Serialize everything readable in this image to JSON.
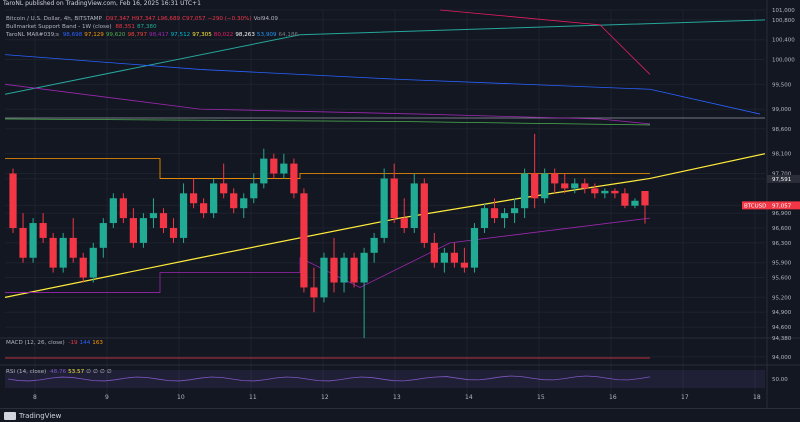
{
  "header": {
    "publisher": "TaroNL published on TradingView.com, Feb 16, 2025 16:31 UTC+1"
  },
  "legend": {
    "title_line": "Bitcoin / U.S. Dollar, 4h, BITSTAMP",
    "ohlc": [
      "O97,347",
      "H97,347",
      "L96,689",
      "C97,057",
      "−290 (−0.30%)",
      "Vol94.09"
    ],
    "band_label": "Bullmarket Support Band - 1W (close)",
    "band_values": [
      "88,351",
      "87,380"
    ],
    "ma_label": "TaroNL MAß#039;s",
    "ma_values": [
      "98,698",
      "97,129",
      "99,620",
      "98,797",
      "98,417",
      "97,512",
      "97,305",
      "80,022",
      "98,263",
      "53,909",
      "64,186"
    ],
    "ma_colors": [
      "#2962ff",
      "#ff9800",
      "#4caf50",
      "#f44336",
      "#9c27b0",
      "#00bcd4",
      "#ffeb3b",
      "#e91e63",
      "#ffffff",
      "#2196f3",
      "#787b86"
    ]
  },
  "macd": {
    "label": "MACD (12, 26, close)",
    "values": [
      "-19",
      "144",
      "163"
    ],
    "colors": [
      "#f23645",
      "#2962ff",
      "#ff9800"
    ]
  },
  "rsi": {
    "label": "RSI (14, close)",
    "values": [
      "48.76",
      "53.57",
      "∅",
      "∅",
      "∅",
      "∅"
    ]
  },
  "footer": {
    "brand": "TradingView"
  },
  "colors": {
    "up": "#22ab94",
    "down": "#f23645",
    "background": "#131722",
    "grid": "#1e222d"
  },
  "price_axis": {
    "labels": [
      "101,000",
      "100,800",
      "100,400",
      "100,000",
      "99,500",
      "99,000",
      "98,600",
      "98,100",
      "97,700",
      "97,591",
      "97,057",
      "96,900",
      "96,600",
      "96,300",
      "95,900",
      "95,600",
      "95,200",
      "94,900",
      "94,600",
      "94,380",
      "94,000"
    ],
    "current_price_tag": "97,591",
    "btc_tag_label": "BTCUSD",
    "btc_tag_value": "97,057"
  },
  "time_axis": {
    "labels": [
      "8",
      "9",
      "10",
      "11",
      "12",
      "13",
      "14",
      "15",
      "16",
      "17",
      "18"
    ]
  },
  "rsi_axis": {
    "label": "50.00"
  },
  "chart_data": {
    "type": "candlestick",
    "title": "Bitcoin / U.S. Dollar, 4h, BITSTAMP",
    "x": [
      "8",
      "9",
      "10",
      "11",
      "12",
      "13",
      "14",
      "15",
      "16",
      "17",
      "18"
    ],
    "ylim": [
      94380,
      101000
    ],
    "candles": [
      {
        "o": 97700,
        "h": 97800,
        "l": 96500,
        "c": 96600
      },
      {
        "o": 96600,
        "h": 96900,
        "l": 95900,
        "c": 96000
      },
      {
        "o": 96000,
        "h": 96800,
        "l": 95900,
        "c": 96700
      },
      {
        "o": 96700,
        "h": 96900,
        "l": 96300,
        "c": 96400
      },
      {
        "o": 96400,
        "h": 96500,
        "l": 95700,
        "c": 95800
      },
      {
        "o": 95800,
        "h": 96500,
        "l": 95700,
        "c": 96400
      },
      {
        "o": 96400,
        "h": 96800,
        "l": 95900,
        "c": 96000
      },
      {
        "o": 96000,
        "h": 96100,
        "l": 95500,
        "c": 95600
      },
      {
        "o": 95600,
        "h": 96300,
        "l": 95500,
        "c": 96200
      },
      {
        "o": 96200,
        "h": 96800,
        "l": 96000,
        "c": 96700
      },
      {
        "o": 96700,
        "h": 97300,
        "l": 96600,
        "c": 97200
      },
      {
        "o": 97200,
        "h": 97300,
        "l": 96700,
        "c": 96800
      },
      {
        "o": 96800,
        "h": 97000,
        "l": 96200,
        "c": 96300
      },
      {
        "o": 96300,
        "h": 96900,
        "l": 96200,
        "c": 96800
      },
      {
        "o": 96800,
        "h": 97200,
        "l": 96600,
        "c": 96900
      },
      {
        "o": 96900,
        "h": 97000,
        "l": 96500,
        "c": 96600
      },
      {
        "o": 96600,
        "h": 96800,
        "l": 96300,
        "c": 96400
      },
      {
        "o": 96400,
        "h": 97500,
        "l": 96300,
        "c": 97300
      },
      {
        "o": 97300,
        "h": 97600,
        "l": 97000,
        "c": 97100
      },
      {
        "o": 97100,
        "h": 97200,
        "l": 96800,
        "c": 96900
      },
      {
        "o": 96900,
        "h": 97600,
        "l": 96800,
        "c": 97500
      },
      {
        "o": 97500,
        "h": 97900,
        "l": 97200,
        "c": 97300
      },
      {
        "o": 97300,
        "h": 97400,
        "l": 96900,
        "c": 97000
      },
      {
        "o": 97000,
        "h": 97300,
        "l": 96800,
        "c": 97200
      },
      {
        "o": 97200,
        "h": 97700,
        "l": 97100,
        "c": 97500
      },
      {
        "o": 97500,
        "h": 98200,
        "l": 97400,
        "c": 98000
      },
      {
        "o": 98000,
        "h": 98100,
        "l": 97600,
        "c": 97700
      },
      {
        "o": 97700,
        "h": 98100,
        "l": 97600,
        "c": 97900
      },
      {
        "o": 97900,
        "h": 98000,
        "l": 97200,
        "c": 97300
      },
      {
        "o": 97300,
        "h": 97400,
        "l": 95300,
        "c": 95400
      },
      {
        "o": 95400,
        "h": 95800,
        "l": 94900,
        "c": 95200
      },
      {
        "o": 95200,
        "h": 96100,
        "l": 95100,
        "c": 96000
      },
      {
        "o": 96000,
        "h": 96400,
        "l": 95300,
        "c": 95500
      },
      {
        "o": 95500,
        "h": 96100,
        "l": 95300,
        "c": 96000
      },
      {
        "o": 96000,
        "h": 96100,
        "l": 95400,
        "c": 95500
      },
      {
        "o": 95500,
        "h": 96200,
        "l": 94380,
        "c": 96100
      },
      {
        "o": 96100,
        "h": 96500,
        "l": 95900,
        "c": 96400
      },
      {
        "o": 96400,
        "h": 97800,
        "l": 96300,
        "c": 97600
      },
      {
        "o": 97600,
        "h": 97900,
        "l": 96700,
        "c": 96800
      },
      {
        "o": 96800,
        "h": 97200,
        "l": 96500,
        "c": 96600
      },
      {
        "o": 96600,
        "h": 97700,
        "l": 96500,
        "c": 97500
      },
      {
        "o": 97500,
        "h": 97600,
        "l": 96200,
        "c": 96300
      },
      {
        "o": 96300,
        "h": 96500,
        "l": 95800,
        "c": 95900
      },
      {
        "o": 95900,
        "h": 96200,
        "l": 95700,
        "c": 96100
      },
      {
        "o": 96100,
        "h": 96300,
        "l": 95800,
        "c": 95900
      },
      {
        "o": 95900,
        "h": 96200,
        "l": 95700,
        "c": 95800
      },
      {
        "o": 95800,
        "h": 96700,
        "l": 95700,
        "c": 96600
      },
      {
        "o": 96600,
        "h": 97100,
        "l": 96500,
        "c": 97000
      },
      {
        "o": 97000,
        "h": 97200,
        "l": 96700,
        "c": 96800
      },
      {
        "o": 96800,
        "h": 97000,
        "l": 96600,
        "c": 96900
      },
      {
        "o": 96900,
        "h": 97200,
        "l": 96700,
        "c": 97000
      },
      {
        "o": 97000,
        "h": 97800,
        "l": 96800,
        "c": 97700
      },
      {
        "o": 97700,
        "h": 98500,
        "l": 97000,
        "c": 97200
      },
      {
        "o": 97200,
        "h": 97800,
        "l": 97100,
        "c": 97700
      },
      {
        "o": 97700,
        "h": 97800,
        "l": 97300,
        "c": 97500
      },
      {
        "o": 97500,
        "h": 97700,
        "l": 97300,
        "c": 97400
      },
      {
        "o": 97400,
        "h": 97600,
        "l": 97300,
        "c": 97500
      },
      {
        "o": 97500,
        "h": 97600,
        "l": 97300,
        "c": 97400
      },
      {
        "o": 97400,
        "h": 97500,
        "l": 97200,
        "c": 97300
      },
      {
        "o": 97300,
        "h": 97400,
        "l": 97200,
        "c": 97350
      },
      {
        "o": 97350,
        "h": 97400,
        "l": 97200,
        "c": 97300
      },
      {
        "o": 97300,
        "h": 97400,
        "l": 97000,
        "c": 97050
      },
      {
        "o": 97050,
        "h": 97200,
        "l": 97000,
        "c": 97150
      },
      {
        "o": 97347,
        "h": 97347,
        "l": 96689,
        "c": 97057
      }
    ]
  }
}
